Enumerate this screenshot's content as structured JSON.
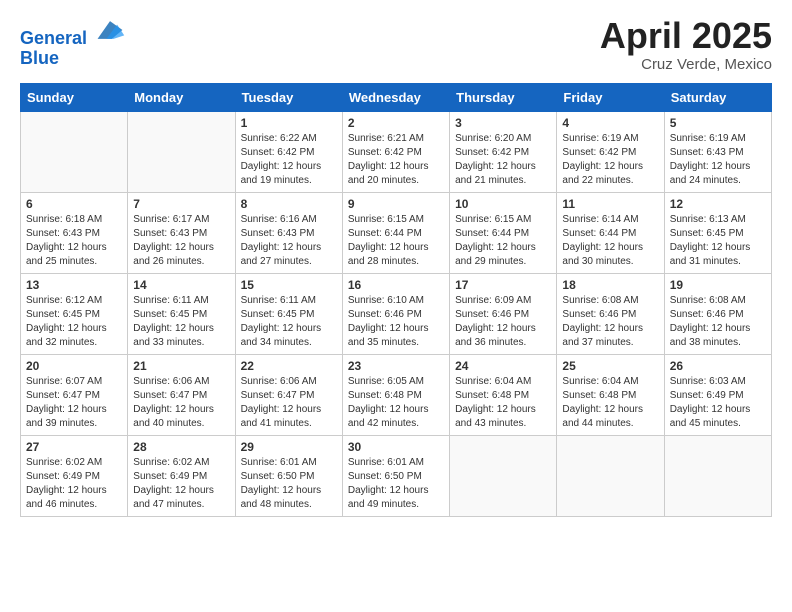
{
  "header": {
    "logo_line1": "General",
    "logo_line2": "Blue",
    "month_title": "April 2025",
    "subtitle": "Cruz Verde, Mexico"
  },
  "weekdays": [
    "Sunday",
    "Monday",
    "Tuesday",
    "Wednesday",
    "Thursday",
    "Friday",
    "Saturday"
  ],
  "weeks": [
    [
      {
        "day": "",
        "info": ""
      },
      {
        "day": "",
        "info": ""
      },
      {
        "day": "1",
        "info": "Sunrise: 6:22 AM\nSunset: 6:42 PM\nDaylight: 12 hours and 19 minutes."
      },
      {
        "day": "2",
        "info": "Sunrise: 6:21 AM\nSunset: 6:42 PM\nDaylight: 12 hours and 20 minutes."
      },
      {
        "day": "3",
        "info": "Sunrise: 6:20 AM\nSunset: 6:42 PM\nDaylight: 12 hours and 21 minutes."
      },
      {
        "day": "4",
        "info": "Sunrise: 6:19 AM\nSunset: 6:42 PM\nDaylight: 12 hours and 22 minutes."
      },
      {
        "day": "5",
        "info": "Sunrise: 6:19 AM\nSunset: 6:43 PM\nDaylight: 12 hours and 24 minutes."
      }
    ],
    [
      {
        "day": "6",
        "info": "Sunrise: 6:18 AM\nSunset: 6:43 PM\nDaylight: 12 hours and 25 minutes."
      },
      {
        "day": "7",
        "info": "Sunrise: 6:17 AM\nSunset: 6:43 PM\nDaylight: 12 hours and 26 minutes."
      },
      {
        "day": "8",
        "info": "Sunrise: 6:16 AM\nSunset: 6:43 PM\nDaylight: 12 hours and 27 minutes."
      },
      {
        "day": "9",
        "info": "Sunrise: 6:15 AM\nSunset: 6:44 PM\nDaylight: 12 hours and 28 minutes."
      },
      {
        "day": "10",
        "info": "Sunrise: 6:15 AM\nSunset: 6:44 PM\nDaylight: 12 hours and 29 minutes."
      },
      {
        "day": "11",
        "info": "Sunrise: 6:14 AM\nSunset: 6:44 PM\nDaylight: 12 hours and 30 minutes."
      },
      {
        "day": "12",
        "info": "Sunrise: 6:13 AM\nSunset: 6:45 PM\nDaylight: 12 hours and 31 minutes."
      }
    ],
    [
      {
        "day": "13",
        "info": "Sunrise: 6:12 AM\nSunset: 6:45 PM\nDaylight: 12 hours and 32 minutes."
      },
      {
        "day": "14",
        "info": "Sunrise: 6:11 AM\nSunset: 6:45 PM\nDaylight: 12 hours and 33 minutes."
      },
      {
        "day": "15",
        "info": "Sunrise: 6:11 AM\nSunset: 6:45 PM\nDaylight: 12 hours and 34 minutes."
      },
      {
        "day": "16",
        "info": "Sunrise: 6:10 AM\nSunset: 6:46 PM\nDaylight: 12 hours and 35 minutes."
      },
      {
        "day": "17",
        "info": "Sunrise: 6:09 AM\nSunset: 6:46 PM\nDaylight: 12 hours and 36 minutes."
      },
      {
        "day": "18",
        "info": "Sunrise: 6:08 AM\nSunset: 6:46 PM\nDaylight: 12 hours and 37 minutes."
      },
      {
        "day": "19",
        "info": "Sunrise: 6:08 AM\nSunset: 6:46 PM\nDaylight: 12 hours and 38 minutes."
      }
    ],
    [
      {
        "day": "20",
        "info": "Sunrise: 6:07 AM\nSunset: 6:47 PM\nDaylight: 12 hours and 39 minutes."
      },
      {
        "day": "21",
        "info": "Sunrise: 6:06 AM\nSunset: 6:47 PM\nDaylight: 12 hours and 40 minutes."
      },
      {
        "day": "22",
        "info": "Sunrise: 6:06 AM\nSunset: 6:47 PM\nDaylight: 12 hours and 41 minutes."
      },
      {
        "day": "23",
        "info": "Sunrise: 6:05 AM\nSunset: 6:48 PM\nDaylight: 12 hours and 42 minutes."
      },
      {
        "day": "24",
        "info": "Sunrise: 6:04 AM\nSunset: 6:48 PM\nDaylight: 12 hours and 43 minutes."
      },
      {
        "day": "25",
        "info": "Sunrise: 6:04 AM\nSunset: 6:48 PM\nDaylight: 12 hours and 44 minutes."
      },
      {
        "day": "26",
        "info": "Sunrise: 6:03 AM\nSunset: 6:49 PM\nDaylight: 12 hours and 45 minutes."
      }
    ],
    [
      {
        "day": "27",
        "info": "Sunrise: 6:02 AM\nSunset: 6:49 PM\nDaylight: 12 hours and 46 minutes."
      },
      {
        "day": "28",
        "info": "Sunrise: 6:02 AM\nSunset: 6:49 PM\nDaylight: 12 hours and 47 minutes."
      },
      {
        "day": "29",
        "info": "Sunrise: 6:01 AM\nSunset: 6:50 PM\nDaylight: 12 hours and 48 minutes."
      },
      {
        "day": "30",
        "info": "Sunrise: 6:01 AM\nSunset: 6:50 PM\nDaylight: 12 hours and 49 minutes."
      },
      {
        "day": "",
        "info": ""
      },
      {
        "day": "",
        "info": ""
      },
      {
        "day": "",
        "info": ""
      }
    ]
  ]
}
